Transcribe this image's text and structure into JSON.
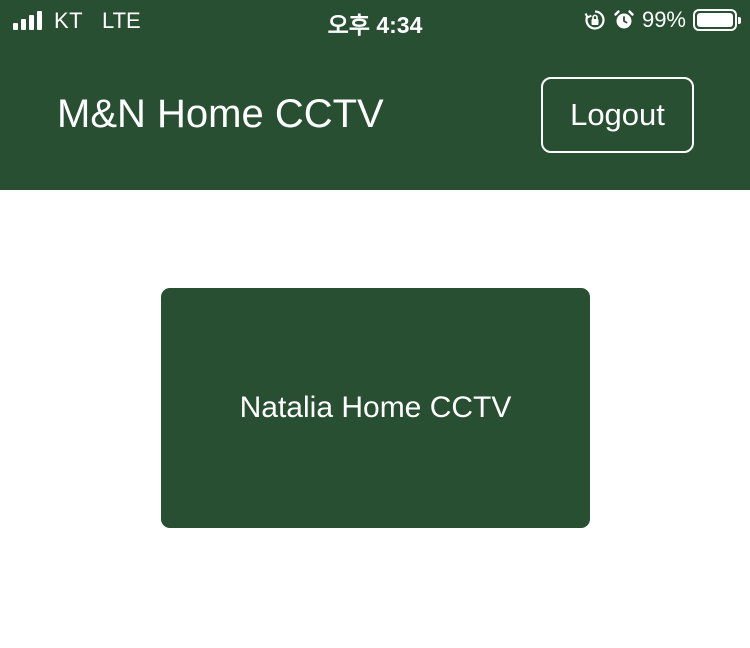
{
  "status_bar": {
    "carrier": "KT",
    "network": "LTE",
    "time": "오후 4:34",
    "battery_percent": "99%",
    "battery_level": 0.99,
    "icons": [
      "signal-bars-icon",
      "rotation-lock-icon",
      "alarm-icon",
      "battery-icon"
    ]
  },
  "header": {
    "title": "M&N Home CCTV",
    "logout_label": "Logout"
  },
  "main": {
    "cameras": [
      {
        "label": "Natalia Home CCTV"
      }
    ]
  },
  "colors": {
    "primary": "#284f31",
    "background": "#ffffff",
    "text_on_primary": "#ffffff"
  }
}
